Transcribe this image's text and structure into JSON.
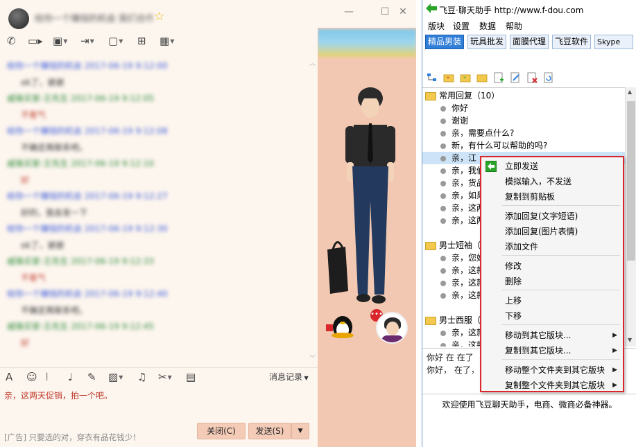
{
  "chat": {
    "contact_name": "给你一个赚钱的机会 我们合作",
    "messages": [
      {
        "type": "hdr-a",
        "text": "给你一个赚钱的机会 2017-06-19 9:12:00"
      },
      {
        "type": "body",
        "text": "ok了，谢谢"
      },
      {
        "type": "hdr-b",
        "text": "威锋买家-王先生 2017-06-19 9:12:05"
      },
      {
        "type": "body red",
        "text": "不客气"
      },
      {
        "type": "hdr-a",
        "text": "给你一个赚钱的机会 2017-06-19 9:12:08"
      },
      {
        "type": "body",
        "text": "不确定再联系吧。"
      },
      {
        "type": "hdr-b",
        "text": "威锋买家-王先生 2017-06-19 9:12:10"
      },
      {
        "type": "body red",
        "text": "好"
      },
      {
        "type": "hdr-a",
        "text": "给你一个赚钱的机会 2017-06-19 9:12:27"
      },
      {
        "type": "body",
        "text": "好的，我会发一下"
      },
      {
        "type": "hdr-a",
        "text": "给你一个赚钱的机会 2017-06-19 9:12:30"
      },
      {
        "type": "body",
        "text": "ok了，谢谢"
      },
      {
        "type": "hdr-b",
        "text": "威锋买家-王先生 2017-06-19 9:12:33"
      },
      {
        "type": "body red",
        "text": "不客气"
      },
      {
        "type": "hdr-a",
        "text": "给你一个赚钱的机会 2017-06-19 9:12:40"
      },
      {
        "type": "body",
        "text": "不确定再联系吧。"
      },
      {
        "type": "hdr-b",
        "text": "威锋买家-王先生 2017-06-19 9:12:45"
      },
      {
        "type": "body red",
        "text": "好"
      }
    ],
    "history_label": "消息记录",
    "input_text": "亲，这两天促销，拍一个吧。",
    "ad_text": "[广告] 只要选的对，穿衣有品花钱少！",
    "close_label": "关闭(C)",
    "send_label": "发送(S)"
  },
  "app": {
    "title": "飞豆·聊天助手 http://www.f-dou.com",
    "menu": [
      "版块",
      "设置",
      "数据",
      "帮助"
    ],
    "tabs": [
      "精品男装",
      "玩具批发",
      "面膜代理",
      "飞豆软件",
      "Skype"
    ],
    "folders": [
      {
        "label": "常用回复（10）"
      },
      {
        "label": "男士短袖（"
      },
      {
        "label": "男士西服（"
      }
    ],
    "items_group1": [
      "你好",
      "谢谢",
      "亲，需要点什么?",
      "新，有什么可以帮助的吗?",
      "亲，江",
      "亲，我们",
      "亲，货品",
      "亲，如果",
      "亲，这两",
      "亲，这两"
    ],
    "items_group2": [
      "亲，您好",
      "亲，这款",
      "亲，这款",
      "亲，这款"
    ],
    "items_group3": [
      "亲，这款",
      "亲，这款"
    ],
    "preview_a": "你好  在  在了",
    "preview_b": "你好，  在了，",
    "welcome": "欢迎使用飞豆聊天助手，电商、微商必备神器。"
  },
  "context_menu": {
    "items": [
      {
        "label": "立即发送",
        "submenu": false
      },
      {
        "label": "模拟输入，不发送",
        "submenu": false
      },
      {
        "label": "复制到剪贴板",
        "submenu": false
      },
      {
        "label": "添加回复(文字短语)",
        "submenu": false
      },
      {
        "label": "添加回复(图片表情)",
        "submenu": false
      },
      {
        "label": "添加文件",
        "submenu": false
      },
      {
        "label": "修改",
        "submenu": false
      },
      {
        "label": "删除",
        "submenu": false
      },
      {
        "label": "上移",
        "submenu": false
      },
      {
        "label": "下移",
        "submenu": false
      },
      {
        "label": "移动到其它版块...",
        "submenu": true
      },
      {
        "label": "复制到其它版块...",
        "submenu": true
      },
      {
        "label": "移动整个文件夹到其它版块",
        "submenu": true
      },
      {
        "label": "复制整个文件夹到其它版块",
        "submenu": true
      }
    ]
  },
  "colors": {
    "accent": "#2f7ed8",
    "menu_border": "#d9262b",
    "panel_bg": "#f2c8b2"
  }
}
